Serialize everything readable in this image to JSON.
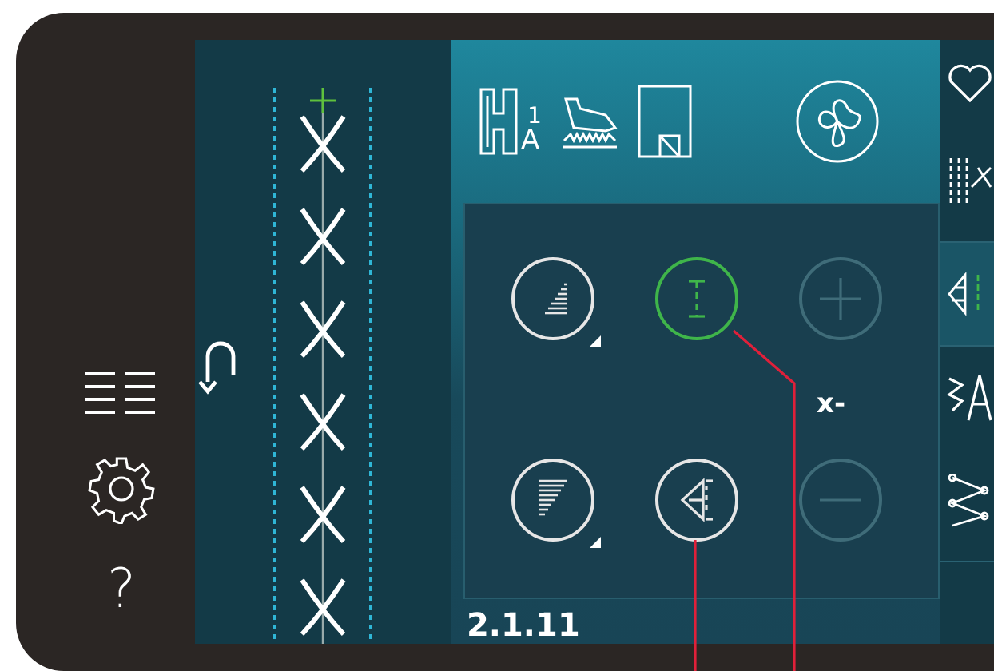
{
  "side_menu": {
    "help_symbol": "?"
  },
  "header": {
    "foot_number": "1",
    "foot_letter": "A"
  },
  "controls": [
    {
      "kind": "taper-in",
      "selected": false,
      "disabled": false,
      "has_submenu": true
    },
    {
      "kind": "length",
      "selected": true,
      "disabled": false,
      "has_submenu": false
    },
    {
      "kind": "plus",
      "selected": false,
      "disabled": true,
      "has_submenu": false
    },
    {
      "kind": "taper-out",
      "selected": false,
      "disabled": false,
      "has_submenu": true
    },
    {
      "kind": "mirror",
      "selected": false,
      "disabled": false,
      "has_submenu": false
    },
    {
      "kind": "minus",
      "selected": false,
      "disabled": true,
      "has_submenu": false
    }
  ],
  "value_label": "x-",
  "stitch_number": "2.1.11"
}
